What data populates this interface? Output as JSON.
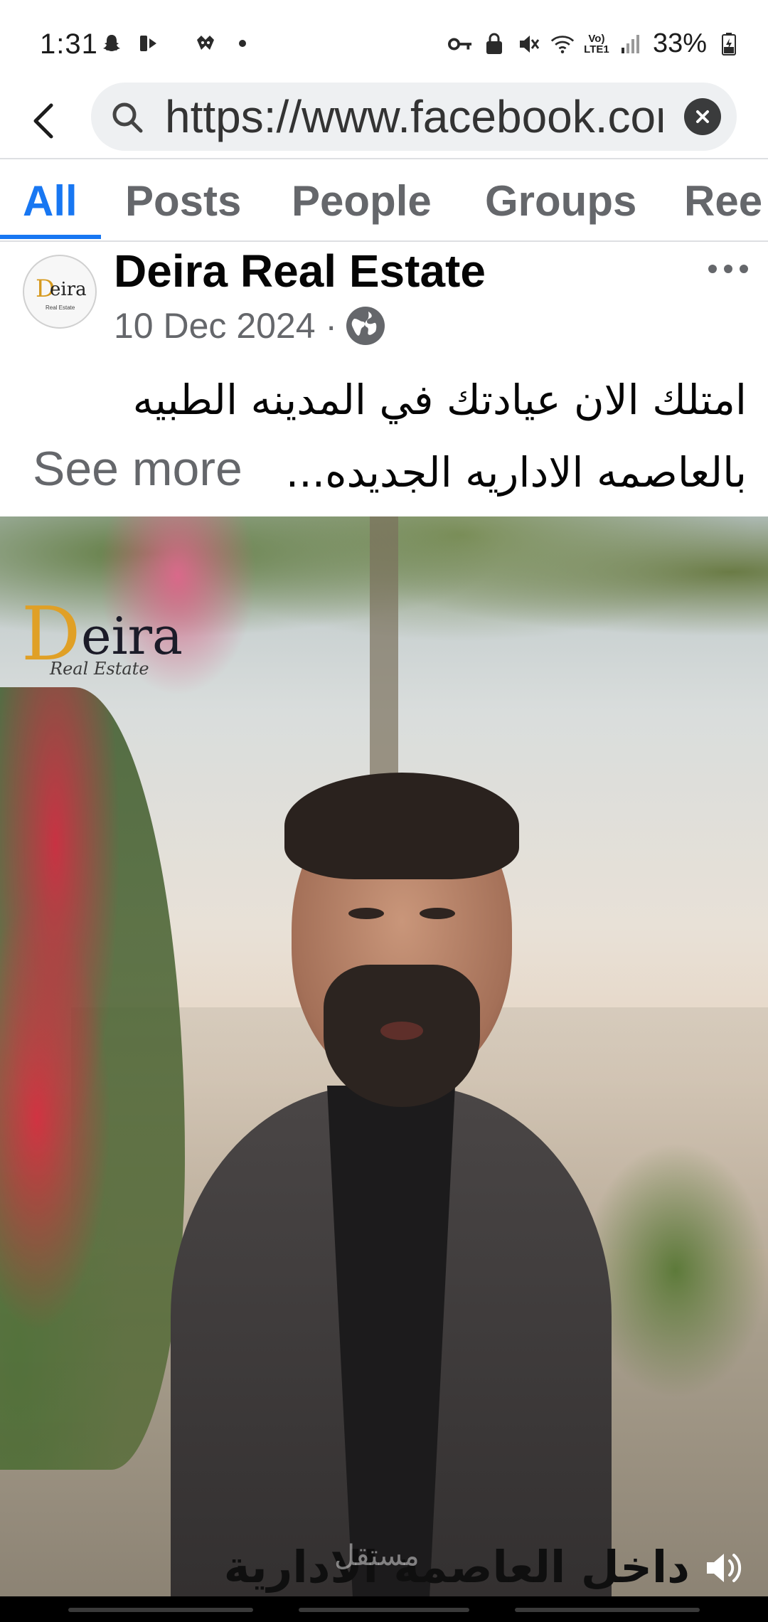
{
  "status_bar": {
    "time": "1:31",
    "battery": "33%",
    "network_label": "Vo) LTE1",
    "icons_left": [
      "snapchat-icon",
      "youtube-shorts-icon",
      "notification-icon",
      "dot-icon"
    ],
    "icons_right": [
      "vpn-key-icon",
      "lock-icon",
      "mute-icon",
      "wifi-icon",
      "lte-icon",
      "signal-icon",
      "battery-icon"
    ]
  },
  "browser": {
    "url": "https://www.facebook.com",
    "back_icon": "back-arrow-icon",
    "search_icon": "search-icon",
    "clear_icon": "clear-icon"
  },
  "tabs": [
    {
      "label": "All",
      "active": true
    },
    {
      "label": "Posts",
      "active": false
    },
    {
      "label": "People",
      "active": false
    },
    {
      "label": "Groups",
      "active": false
    },
    {
      "label": "Ree",
      "active": false
    }
  ],
  "post": {
    "page_name": "Deira Real Estate",
    "date": "10 Dec 2024 ·",
    "privacy_icon": "globe-icon",
    "more_icon": "more-options-icon",
    "text_line1": "امتلك الان عيادتك في المدينه الطبيه",
    "text_line2": "بالعاصمه الاداريه الجديده...",
    "see_more": "See more",
    "avatar_logo": {
      "d": "D",
      "rest": "eira",
      "sub": "Real Estate"
    }
  },
  "video": {
    "logo_d": "D",
    "logo_rest": "eira",
    "logo_sub": "Real Estate",
    "caption": "داخل العاصمة الادارية",
    "watermark": "مستقل",
    "sound_icon": "speaker-icon"
  },
  "colors": {
    "accent": "#1877f2",
    "secondary_text": "#65676b",
    "caption_highlight": "#f0cf1e"
  }
}
